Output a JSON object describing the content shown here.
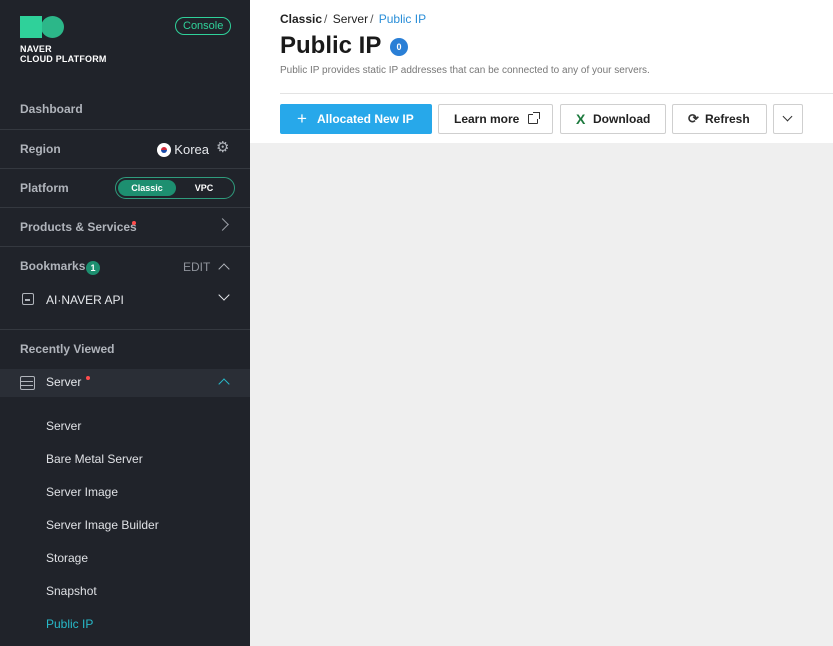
{
  "brand": {
    "line1": "NAVER",
    "line2": "CLOUD PLATFORM",
    "console_label": "Console",
    "accent_color": "#2fd19a"
  },
  "sidebar": {
    "dashboard": "Dashboard",
    "region": {
      "label": "Region",
      "value": "Korea",
      "flag_icon": "korea-flag-icon",
      "settings_icon": "gear-icon"
    },
    "platform": {
      "label": "Platform",
      "options": [
        "Classic",
        "VPC"
      ],
      "selected": "Classic"
    },
    "products": {
      "label": "Products & Services",
      "icon": "chevron-right-icon"
    },
    "bookmarks": {
      "label": "Bookmarks",
      "count": "1",
      "edit_label": "EDIT",
      "items": [
        {
          "label": "AI·NAVER API",
          "icon": "api-icon"
        }
      ]
    },
    "recent": {
      "label": "Recently Viewed",
      "group": {
        "label": "Server",
        "icon": "server-icon"
      },
      "items": [
        {
          "label": "Server"
        },
        {
          "label": "Bare Metal Server"
        },
        {
          "label": "Server Image"
        },
        {
          "label": "Server Image Builder"
        },
        {
          "label": "Storage"
        },
        {
          "label": "Snapshot"
        },
        {
          "label": "Public IP"
        }
      ],
      "active_item": "Public IP"
    }
  },
  "main": {
    "breadcrumb": [
      "Classic",
      "Server",
      "Public IP"
    ],
    "title": "Public IP",
    "count": "0",
    "description": "Public IP provides static IP addresses that can be connected to any of your servers.",
    "actions": {
      "allocate": "Allocated New IP",
      "learn_more": "Learn more",
      "download": "Download",
      "refresh": "Refresh"
    },
    "colors": {
      "primary_button": "#27a8ea",
      "active_link": "#27b9c9"
    }
  }
}
